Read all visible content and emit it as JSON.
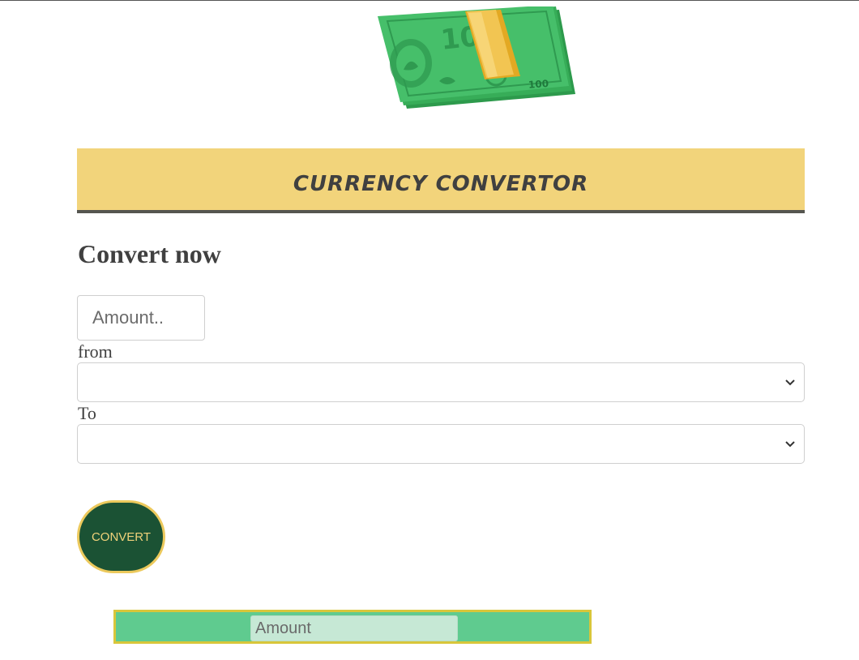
{
  "header": {
    "logo_icon": "money-stack-icon",
    "title": "CURRENCY CONVERTOR",
    "background_color": "#f2d47b"
  },
  "main": {
    "heading": "Convert now",
    "amount_input": {
      "placeholder": "Amount..",
      "value": ""
    },
    "from": {
      "label": "from",
      "selected": ""
    },
    "to": {
      "label": "To",
      "selected": ""
    },
    "convert_button": {
      "label": "CONVERT",
      "background_color": "#1b5234",
      "text_color": "#f0d27a"
    },
    "result": {
      "placeholder": "Amount",
      "value": "",
      "background_color": "#5fcb8f"
    }
  }
}
